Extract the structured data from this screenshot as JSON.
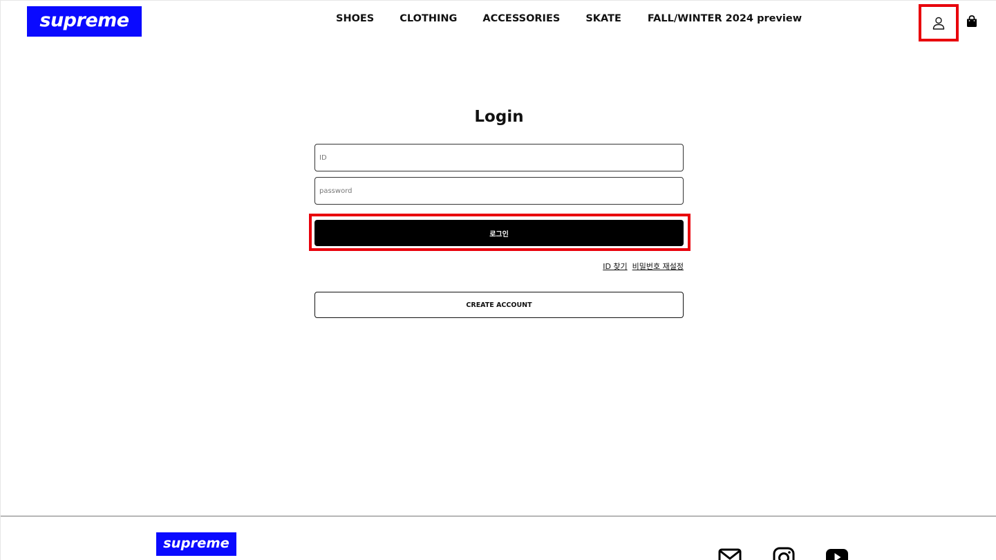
{
  "header": {
    "logo_text": "supreme kr",
    "nav": [
      "SHOES",
      "CLOTHING",
      "ACCESSORIES",
      "SKATE",
      "FALL/WINTER 2024 preview"
    ],
    "user_icon": "user-icon",
    "cart_icon": "shopping-bag-icon"
  },
  "login": {
    "title": "Login",
    "id_placeholder": "ID",
    "password_placeholder": "password",
    "submit_label": "로그인",
    "find_id_label": "ID 찾기",
    "reset_password_label": "비밀번호 재설정",
    "create_account_label": "CREATE ACCOUNT"
  },
  "footer": {
    "logo_text": "supreme kr",
    "social_icons": [
      "mail-icon",
      "instagram-icon",
      "youtube-icon"
    ]
  },
  "colors": {
    "brand_blue": "#0a0aff",
    "highlight_red": "#e8000b",
    "button_black": "#000000"
  }
}
